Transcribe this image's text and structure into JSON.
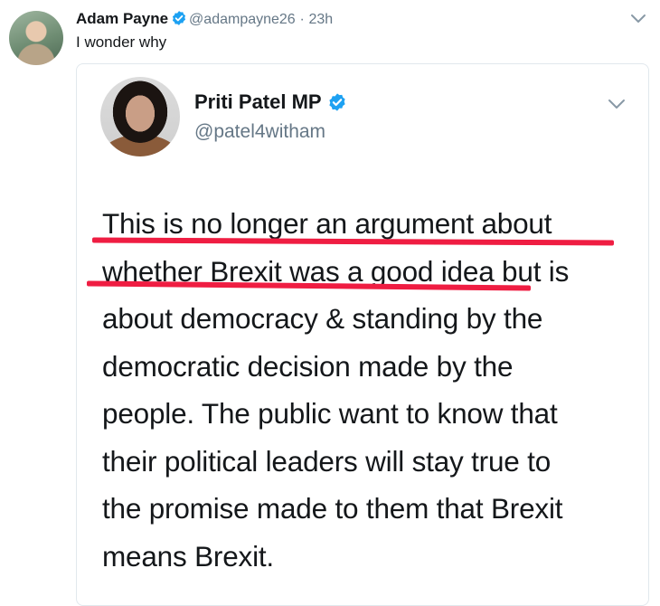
{
  "outer_tweet": {
    "author_name": "Adam Payne",
    "handle": "@adampayne26",
    "separator": "·",
    "time": "23h",
    "text": "I wonder why"
  },
  "quoted_tweet": {
    "author_name": "Priti Patel MP",
    "handle": "@patel4witham",
    "lines": [
      "This is no longer an argument about",
      "whether Brexit was a good idea but is",
      "about democracy & standing by the",
      "democratic decision made by the",
      "people. The public want to know that",
      "their political leaders will stay true to",
      "the promise made to them that Brexit",
      "means Brexit."
    ]
  },
  "colors": {
    "verified": "#1da1f2",
    "underline": "#ef1d42",
    "secondary_text": "#657786",
    "border": "#e1e8ed"
  },
  "icons": {
    "verified": "verified-badge-icon",
    "caret": "chevron-down-icon"
  }
}
